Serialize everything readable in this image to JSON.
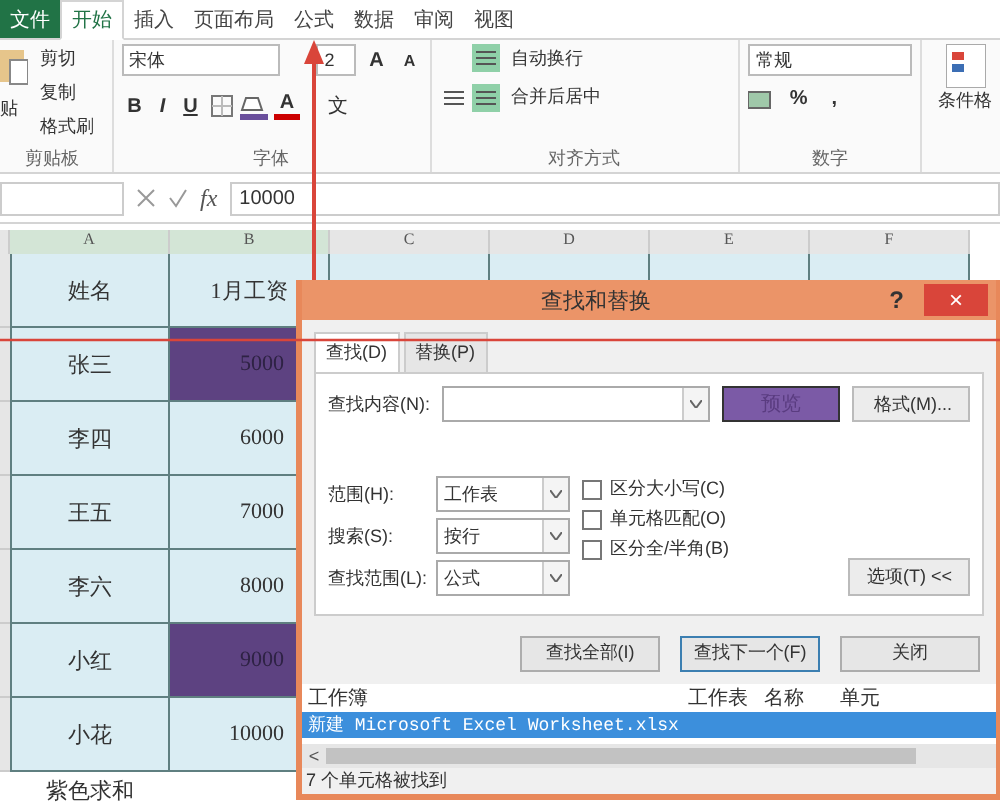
{
  "ribbon_tabs": [
    {
      "label": "文件",
      "kind": "file",
      "selected": false
    },
    {
      "label": "开始",
      "kind": "tab",
      "selected": true
    },
    {
      "label": "插入",
      "kind": "tab",
      "selected": false
    },
    {
      "label": "页面布局",
      "kind": "tab",
      "selected": false
    },
    {
      "label": "公式",
      "kind": "tab",
      "selected": false
    },
    {
      "label": "数据",
      "kind": "tab",
      "selected": false
    },
    {
      "label": "审阅",
      "kind": "tab",
      "selected": false
    },
    {
      "label": "视图",
      "kind": "tab",
      "selected": false
    }
  ],
  "clipboard": {
    "paste": "贴",
    "items": [
      "剪切",
      "复制",
      "格式刷"
    ],
    "label": "剪贴板"
  },
  "font": {
    "name": "宋体",
    "size": "2",
    "grow": "A",
    "shrink": "A",
    "styles": [
      "B",
      "I",
      "U"
    ],
    "color_letter": "A",
    "phonetic": "文",
    "label": "字体"
  },
  "alignment": {
    "wrap": "自动换行",
    "merge": "合并后居中",
    "label": "对齐方式"
  },
  "number": {
    "format": "常规",
    "percent": "%",
    "comma": ",",
    "label": "数字"
  },
  "styles": {
    "conditional": "条件格"
  },
  "formula_bar": {
    "fx": "fx",
    "value": "10000"
  },
  "columns": [
    "A",
    "B",
    "C",
    "D",
    "E",
    "F"
  ],
  "rows": [
    {
      "name": "姓名",
      "salary": "1月工资",
      "highlighted": false
    },
    {
      "name": "张三",
      "salary": "5000",
      "highlighted": true
    },
    {
      "name": "李四",
      "salary": "6000",
      "highlighted": false
    },
    {
      "name": "王五",
      "salary": "7000",
      "highlighted": false
    },
    {
      "name": "李六",
      "salary": "8000",
      "highlighted": false
    },
    {
      "name": "小红",
      "salary": "9000",
      "highlighted": true
    },
    {
      "name": "小花",
      "salary": "10000",
      "highlighted": false
    }
  ],
  "footer_label": "紫色求和",
  "dialog": {
    "title": "查找和替换",
    "help": "?",
    "close": "×",
    "tabs": [
      {
        "label": "查找(D)",
        "selected": true
      },
      {
        "label": "替换(P)",
        "selected": false
      }
    ],
    "find_label": "查找内容(N):",
    "preview": "预览",
    "format_button": "格式(M)...",
    "options": [
      {
        "label": "范围(H):",
        "value": "工作表"
      },
      {
        "label": "搜索(S):",
        "value": "按行"
      },
      {
        "label": "查找范围(L):",
        "value": "公式"
      }
    ],
    "checkboxes": [
      {
        "label": "区分大小写(C)",
        "checked": false
      },
      {
        "label": "单元格匹配(O)",
        "checked": false
      },
      {
        "label": "区分全/半角(B)",
        "checked": false
      }
    ],
    "options_button": "选项(T) <<",
    "buttons": [
      "查找全部(I)",
      "查找下一个(F)",
      "关闭"
    ],
    "result_columns": [
      "工作簿",
      "工作表",
      "名称",
      "单元"
    ],
    "results": [
      {
        "workbook": "新建 Microsoft Excel Worksheet.xlsx",
        "selected": true
      }
    ],
    "scroll_left": "<",
    "status": "7 个单元格被找到"
  }
}
